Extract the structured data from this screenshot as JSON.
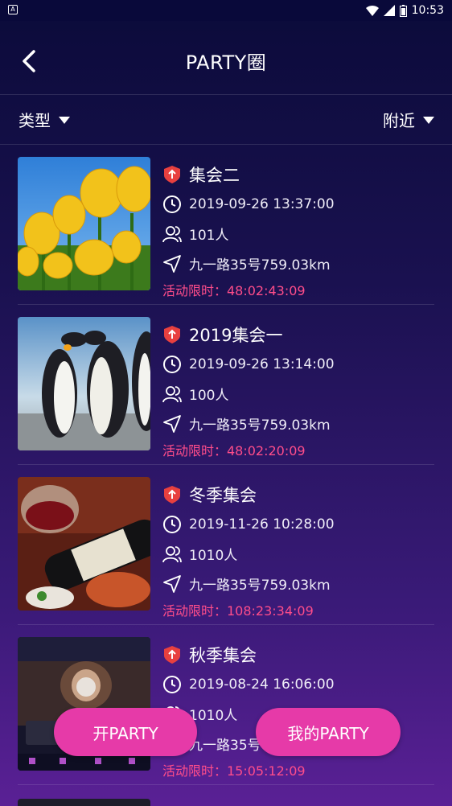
{
  "status_bar": {
    "time": "10:53"
  },
  "header": {
    "title": "PARTY圈"
  },
  "filters": {
    "type_label": "类型",
    "nearby_label": "附近"
  },
  "events": [
    {
      "name": "集会二",
      "datetime": "2019-09-26 13:37:00",
      "people": "101人",
      "location": "九一路35号759.03km",
      "limit": "活动限时：48:02:43:09"
    },
    {
      "name": "2019集会一",
      "datetime": "2019-09-26 13:14:00",
      "people": "100人",
      "location": "九一路35号759.03km",
      "limit": "活动限时：48:02:20:09"
    },
    {
      "name": "冬季集会",
      "datetime": "2019-11-26 10:28:00",
      "people": "1010人",
      "location": "九一路35号759.03km",
      "limit": "活动限时：108:23:34:09"
    },
    {
      "name": "秋季集会",
      "datetime": "2019-08-24 16:06:00",
      "people": "1010人",
      "location": "九一路35号759.03km",
      "limit": "活动限时：15:05:12:09"
    }
  ],
  "actions": {
    "open_party": "开PARTY",
    "my_party": "我的PARTY"
  },
  "colors": {
    "accent": "#e63aa8",
    "limit_text": "#ff4d8a",
    "badge": "#e8403f"
  }
}
